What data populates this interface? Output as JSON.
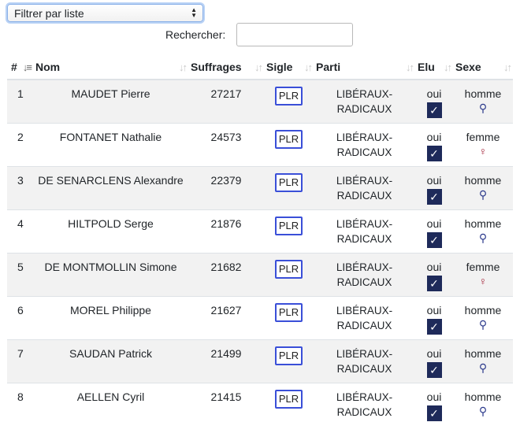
{
  "filter": {
    "label": "Filtrer par liste"
  },
  "search": {
    "label": "Rechercher:",
    "value": ""
  },
  "columns": {
    "num": "#",
    "nom": "Nom",
    "suffrages": "Suffrages",
    "sigle": "Sigle",
    "parti": "Parti",
    "elu": "Elu",
    "sexe": "Sexe"
  },
  "rows": [
    {
      "num": "1",
      "nom": "MAUDET Pierre",
      "suffrages": "27217",
      "sigle": "PLR",
      "parti1": "LIBÉRAUX-",
      "parti2": "RADICAUX",
      "elu": "oui",
      "check": "✓",
      "sexe": "homme",
      "sex_symbol": "⚲",
      "sex_type": "male"
    },
    {
      "num": "2",
      "nom": "FONTANET Nathalie",
      "suffrages": "24573",
      "sigle": "PLR",
      "parti1": "LIBÉRAUX-",
      "parti2": "RADICAUX",
      "elu": "oui",
      "check": "✓",
      "sexe": "femme",
      "sex_symbol": "♀",
      "sex_type": "female"
    },
    {
      "num": "3",
      "nom": "DE SENARCLENS Alexandre",
      "suffrages": "22379",
      "sigle": "PLR",
      "parti1": "LIBÉRAUX-",
      "parti2": "RADICAUX",
      "elu": "oui",
      "check": "✓",
      "sexe": "homme",
      "sex_symbol": "⚲",
      "sex_type": "male"
    },
    {
      "num": "4",
      "nom": "HILTPOLD Serge",
      "suffrages": "21876",
      "sigle": "PLR",
      "parti1": "LIBÉRAUX-",
      "parti2": "RADICAUX",
      "elu": "oui",
      "check": "✓",
      "sexe": "homme",
      "sex_symbol": "⚲",
      "sex_type": "male"
    },
    {
      "num": "5",
      "nom": "DE MONTMOLLIN Simone",
      "suffrages": "21682",
      "sigle": "PLR",
      "parti1": "LIBÉRAUX-",
      "parti2": "RADICAUX",
      "elu": "oui",
      "check": "✓",
      "sexe": "femme",
      "sex_symbol": "♀",
      "sex_type": "female"
    },
    {
      "num": "6",
      "nom": "MOREL Philippe",
      "suffrages": "21627",
      "sigle": "PLR",
      "parti1": "LIBÉRAUX-",
      "parti2": "RADICAUX",
      "elu": "oui",
      "check": "✓",
      "sexe": "homme",
      "sex_symbol": "⚲",
      "sex_type": "male"
    },
    {
      "num": "7",
      "nom": "SAUDAN Patrick",
      "suffrages": "21499",
      "sigle": "PLR",
      "parti1": "LIBÉRAUX-",
      "parti2": "RADICAUX",
      "elu": "oui",
      "check": "✓",
      "sexe": "homme",
      "sex_symbol": "⚲",
      "sex_type": "male"
    },
    {
      "num": "8",
      "nom": "AELLEN Cyril",
      "suffrages": "21415",
      "sigle": "PLR",
      "parti1": "LIBÉRAUX-",
      "parti2": "RADICAUX",
      "elu": "oui",
      "check": "✓",
      "sexe": "homme",
      "sex_symbol": "⚲",
      "sex_type": "male"
    }
  ],
  "colors": {
    "badge_border": "#3a4fd8",
    "check_bg": "#1e2a5a",
    "male": "#2c3a8c",
    "female": "#a4253a",
    "stripe": "#f2f2f2"
  }
}
